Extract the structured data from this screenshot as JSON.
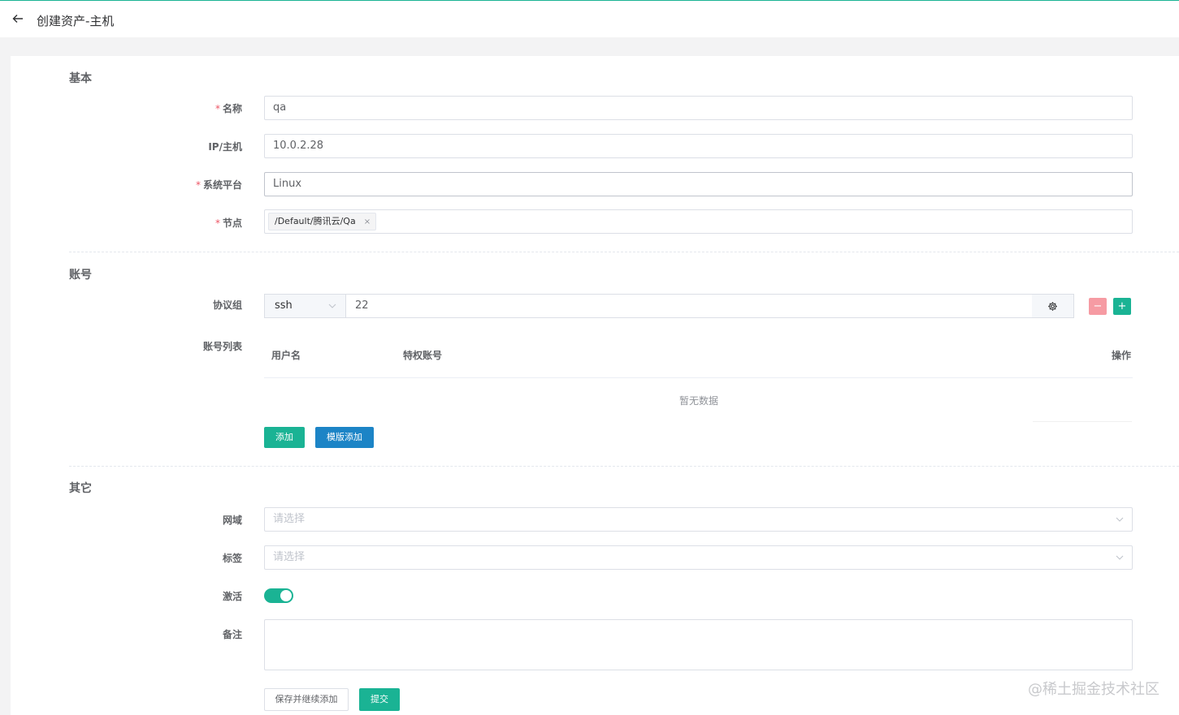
{
  "header": {
    "title": "创建资产-主机"
  },
  "sections": {
    "basic": "基本",
    "account": "账号",
    "other": "其它"
  },
  "basic": {
    "name_label": "名称",
    "name_value": "qa",
    "ip_label": "IP/主机",
    "ip_value": "10.0.2.28",
    "platform_label": "系统平台",
    "platform_value": "Linux",
    "node_label": "节点",
    "node_tag": "/Default/腾讯云/Qa",
    "node_tag_close": "×"
  },
  "account": {
    "protocol_label": "协议组",
    "protocol_value": "ssh",
    "port_value": "22",
    "remove_btn": "−",
    "add_btn": "+",
    "list_label": "账号列表",
    "columns": [
      "用户名",
      "特权账号",
      "操作"
    ],
    "empty_text": "暂无数据",
    "add_label": "添加",
    "template_add_label": "模版添加"
  },
  "other": {
    "domain_label": "网域",
    "domain_placeholder": "请选择",
    "labels_label": "标签",
    "labels_placeholder": "请选择",
    "active_label": "激活",
    "active": true,
    "comment_label": "备注",
    "comment_value": ""
  },
  "footer": {
    "save_continue": "保存并继续添加",
    "submit": "提交"
  },
  "watermark": "@稀土掘金技术社区",
  "colors": {
    "primary": "#1ab394",
    "info": "#1c84c6",
    "danger_light": "#f69ba3",
    "required": "#ed5565"
  }
}
